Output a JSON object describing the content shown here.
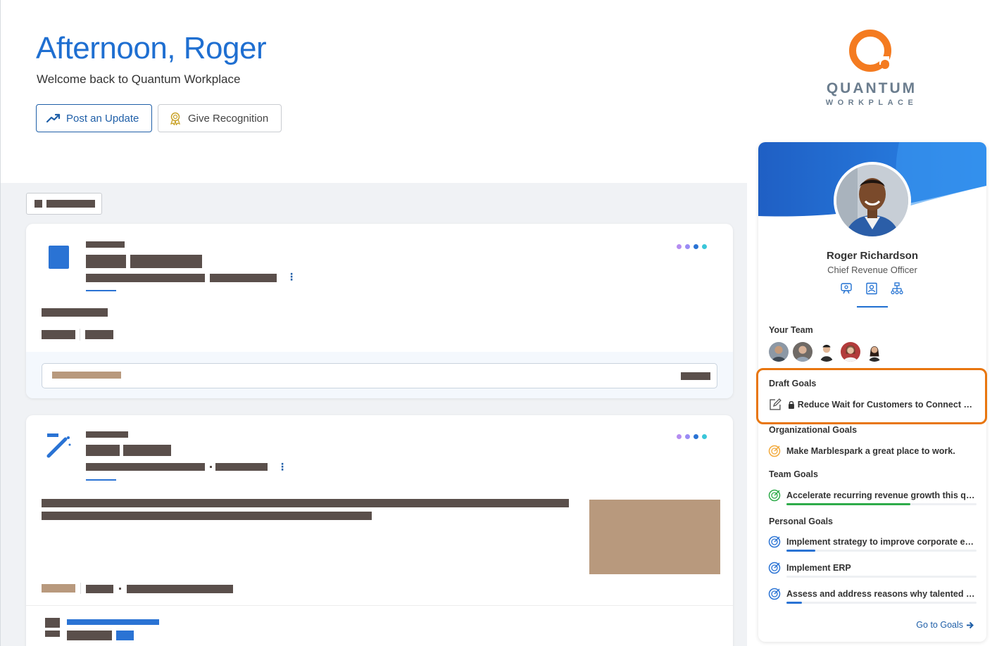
{
  "header": {
    "greeting": "Afternoon, Roger",
    "welcome": "Welcome back to Quantum Workplace",
    "post_update_label": "Post an Update",
    "give_recognition_label": "Give Recognition"
  },
  "logo": {
    "word": "QUANTUM",
    "sub": "WORKPLACE"
  },
  "profile": {
    "name": "Roger Richardson",
    "title": "Chief Revenue Officer",
    "your_team_label": "Your Team",
    "draft_goals_label": "Draft Goals",
    "draft_goal": "Reduce Wait for Customers to Connect wit...",
    "org_goals_label": "Organizational Goals",
    "org_goal": "Make Marblespark a great place to work.",
    "team_goals_label": "Team Goals",
    "team_goal": "Accelerate recurring revenue growth this qua...",
    "team_goal_progress": 0.65,
    "personal_goals_label": "Personal Goals",
    "personal_goals": [
      {
        "text": "Implement strategy to improve corporate exp...",
        "progress": 0.15
      },
      {
        "text": "Implement ERP",
        "progress": 0
      },
      {
        "text": "Assess and address reasons why talented pe...",
        "progress": 0.08
      }
    ],
    "go_to_goals": "Go to Goals"
  },
  "colors": {
    "accent": "#1f6fd1",
    "highlight": "#e8760f",
    "goal_green": "#2eab4a",
    "goal_orange": "#f2a93b",
    "goal_blue": "#2a73d4"
  }
}
